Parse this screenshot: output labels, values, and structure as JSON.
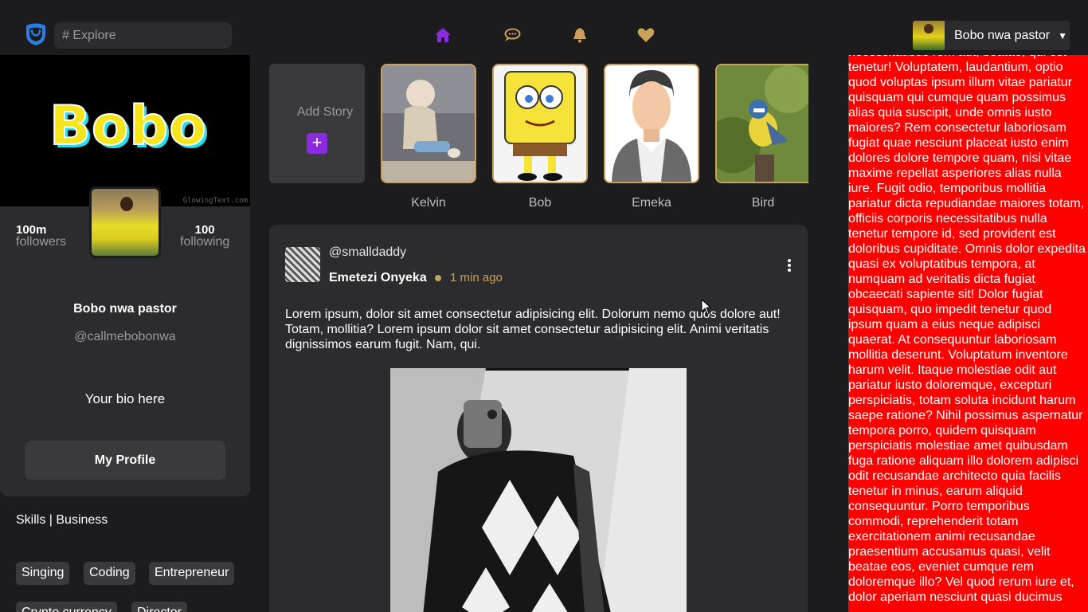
{
  "search": {
    "placeholder": "# Explore"
  },
  "nav": {
    "items": [
      "home-icon",
      "chat-icon",
      "bell-icon",
      "heart-icon"
    ],
    "active_color": "#8a2be2",
    "accent_color": "#c9a15a"
  },
  "user_menu": {
    "name": "Bobo nwa pastor"
  },
  "profile": {
    "cover_text": "Bobo",
    "cover_watermark": "GlowingText.com",
    "followers_count": "100m",
    "followers_label": "followers",
    "following_count": "100",
    "following_label": "following",
    "name": "Bobo nwa pastor",
    "handle": "@callmebobonwa",
    "bio": "Your bio here",
    "button_label": "My Profile"
  },
  "skills": {
    "title": "Skills | Business",
    "tags": [
      "Singing",
      "Coding",
      "Entrepreneur",
      "Crypto currency",
      "Director"
    ]
  },
  "stories": {
    "add_label": "Add Story",
    "add_icon": "+",
    "items": [
      {
        "name": "Kelvin"
      },
      {
        "name": "Bob"
      },
      {
        "name": "Emeka"
      },
      {
        "name": "Bird"
      }
    ]
  },
  "post": {
    "username": "@smalldaddy",
    "author": "Emetezi Onyeka",
    "time": "1 min ago",
    "text": "Lorem ipsum, dolor sit amet consectetur adipisicing elit. Dolorum nemo quos dolore aut! Totam, mollitia? Lorem ipsum dolor sit amet consectetur adipisicing elit. Animi veritatis dignissimos earum fugit. Nam, qui."
  },
  "ad": {
    "background": "#ff0000",
    "text": "necessitatibus rem aut, beatae, qui est tenetur! Voluptatem, laudantium, optio quod voluptas ipsum illum vitae pariatur quisquam qui cumque quam possimus alias quia suscipit, unde omnis iusto maiores? Rem consectetur laboriosam fugiat quae nesciunt placeat iusto enim dolores dolore tempore quam, nisi vitae maxime repellat asperiores alias nulla iure. Fugit odio, temporibus mollitia pariatur dicta repudiandae maiores totam, officiis corporis necessitatibus nulla tenetur tempore id, sed provident est doloribus cupiditate. Omnis dolor expedita quasi ex voluptatibus tempora, at numquam ad veritatis dicta fugiat obcaecati sapiente sit! Dolor fugiat quisquam, quo impedit tenetur quod ipsum quam a eius neque adipisci quaerat. At consequuntur laboriosam mollitia deserunt. Voluptatum inventore harum velit. Itaque molestiae odit aut pariatur iusto doloremque, excepturi perspiciatis, totam soluta incidunt harum saepe ratione? Nihil possimus aspernatur tempora porro, quidem quisquam perspiciatis molestiae amet quibusdam fuga ratione aliquam illo dolorem adipisci odit recusandae architecto quia facilis tenetur in minus, earum aliquid consequuntur. Porro temporibus commodi, reprehenderit totam exercitationem animi recusandae praesentium accusamus quasi, velit beatae eos, eveniet cumque rem doloremque illo? Vel quod rerum iure et, dolor aperiam nesciunt quasi ducimus"
  }
}
